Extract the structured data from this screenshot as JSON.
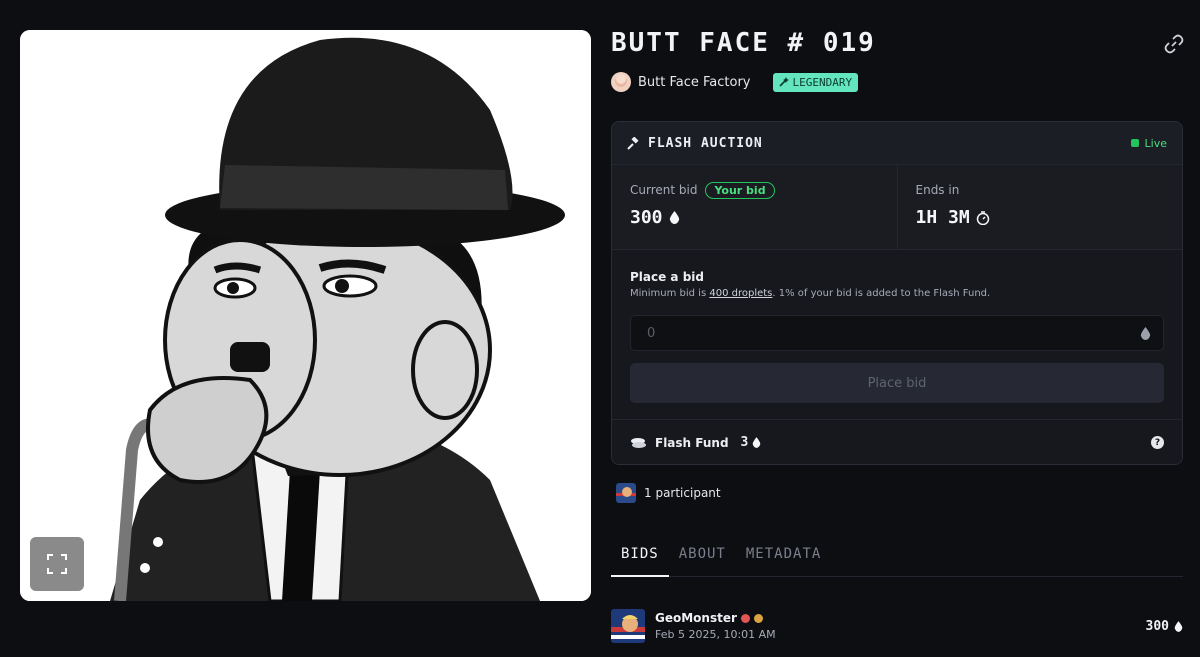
{
  "nft": {
    "title": "BUTT FACE # 019",
    "creator": "Butt Face Factory",
    "rarity": "LEGENDARY"
  },
  "auction": {
    "title": "FLASH AUCTION",
    "status": "Live",
    "current_bid_label": "Current bid",
    "your_bid_badge": "Your bid",
    "current_bid_value": "300",
    "ends_in_label": "Ends in",
    "ends_in_value": "1H 3M",
    "place_bid_heading": "Place a bid",
    "note_prefix": "Minimum bid is ",
    "note_link": "400 droplets",
    "note_suffix": ". 1% of your bid is added to the Flash Fund.",
    "bid_input_placeholder": "0",
    "place_bid_button": "Place bid",
    "flash_fund_label": "Flash Fund",
    "flash_fund_value": "3"
  },
  "participants": {
    "text": "1 participant"
  },
  "tabs": [
    {
      "label": "BIDS",
      "active": true
    },
    {
      "label": "ABOUT",
      "active": false
    },
    {
      "label": "METADATA",
      "active": false
    }
  ],
  "bids": [
    {
      "name": "GeoMonster",
      "time": "Feb 5 2025, 10:01 AM",
      "amount": "300"
    }
  ],
  "colors": {
    "background": "#0d0e12",
    "rarity_badge": "#63e6be",
    "live": "#22c55e"
  }
}
